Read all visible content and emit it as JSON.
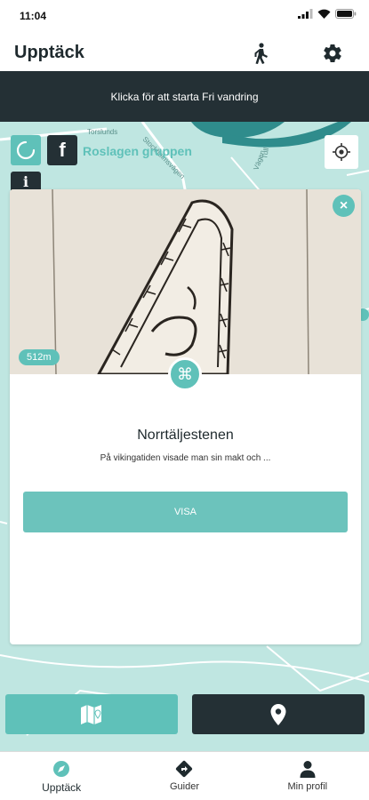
{
  "status_bar": {
    "time": "11:04"
  },
  "header": {
    "title": "Upptäck"
  },
  "banner": {
    "text": "Klicka för att starta Fri vandring"
  },
  "map": {
    "group_name": "Roslagen gruppen",
    "street_labels": [
      "Torslunds",
      "Stockholmsvägen",
      "Vägen",
      "Tull"
    ],
    "colors": {
      "map_bg": "#bfe6e1",
      "road": "#ffffff",
      "water": "#2f8c8c"
    }
  },
  "card": {
    "distance": "512m",
    "title": "Norrtäljestenen",
    "description": "På vikingatiden visade man sin makt och ...",
    "button_label": "VISA",
    "close_symbol": "×",
    "type_icon_symbol": "⌘"
  },
  "bottom_nav": {
    "items": [
      {
        "label": "Upptäck",
        "icon": "compass-icon",
        "active": true
      },
      {
        "label": "Guider",
        "icon": "directions-icon",
        "active": false
      },
      {
        "label": "Min profil",
        "icon": "person-icon",
        "active": false
      }
    ]
  },
  "colors": {
    "accent": "#5fc1b9",
    "dark": "#243035"
  }
}
